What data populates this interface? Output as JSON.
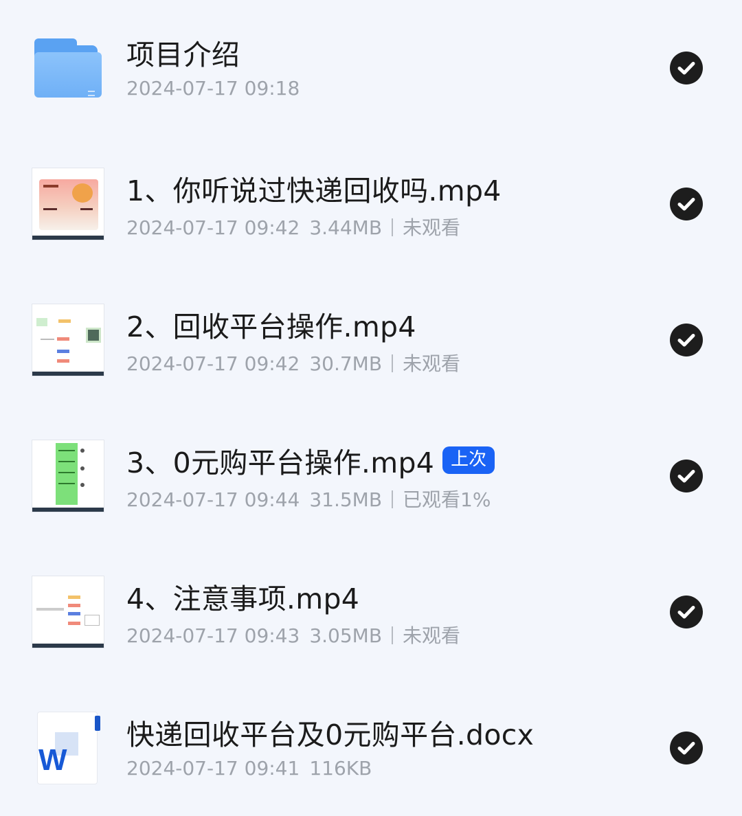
{
  "files": [
    {
      "type": "folder",
      "icon": "folder-icon",
      "name": "项目介绍",
      "date": "2024-07-17 09:18"
    },
    {
      "type": "video",
      "icon": "video-thumbnail",
      "name": "1、你听说过快递回收吗.mp4",
      "date": "2024-07-17 09:42",
      "size": "3.44MB",
      "status": "未观看"
    },
    {
      "type": "video",
      "icon": "video-thumbnail",
      "name": "2、回收平台操作.mp4",
      "date": "2024-07-17 09:42",
      "size": "30.7MB",
      "status": "未观看"
    },
    {
      "type": "video",
      "icon": "video-thumbnail",
      "name": "3、0元购平台操作.mp4",
      "badge": "上次",
      "date": "2024-07-17 09:44",
      "size": "31.5MB",
      "status": "已观看1%"
    },
    {
      "type": "video",
      "icon": "video-thumbnail",
      "name": "4、注意事项.mp4",
      "date": "2024-07-17 09:43",
      "size": "3.05MB",
      "status": "未观看"
    },
    {
      "type": "document",
      "icon": "word-doc-icon",
      "name": "快递回收平台及0元购平台.docx",
      "date": "2024-07-17 09:41",
      "size": "116KB"
    }
  ],
  "colors": {
    "background": "#f3f6fc",
    "check": "#1d1d1d",
    "badge": "#1a63f5",
    "meta": "#9ea3ab"
  }
}
